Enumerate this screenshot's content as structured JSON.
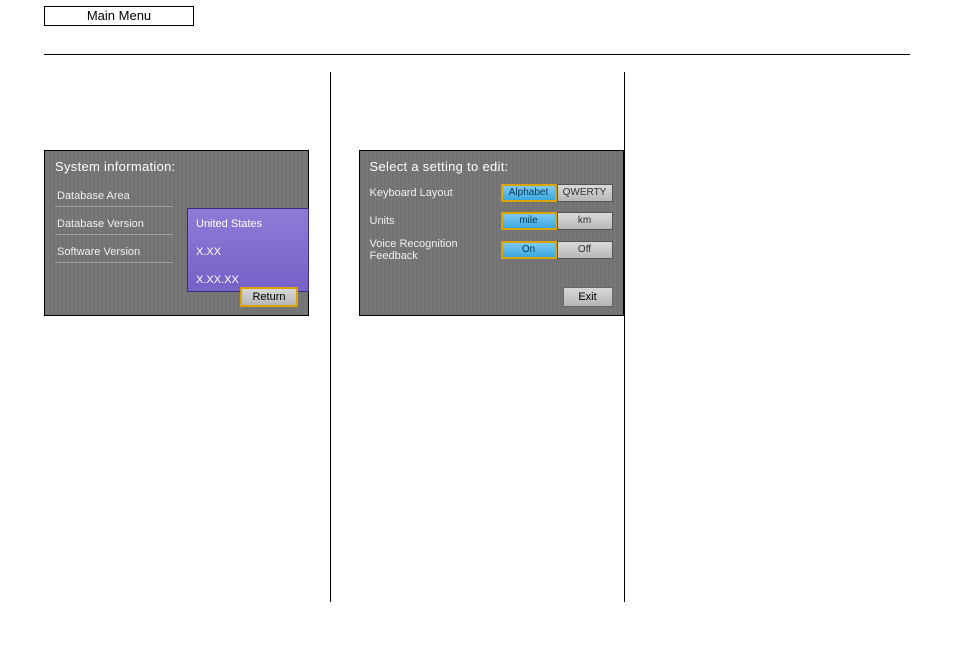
{
  "header": {
    "main_menu": "Main Menu"
  },
  "system_info": {
    "title": "System information:",
    "rows": [
      {
        "label": "Database Area",
        "value": "United States"
      },
      {
        "label": "Database Version",
        "value": "X.XX"
      },
      {
        "label": "Software Version",
        "value": "X.XX.XX"
      }
    ],
    "return_label": "Return"
  },
  "settings": {
    "title": "Select a setting to edit:",
    "rows": [
      {
        "label": "Keyboard Layout",
        "options": [
          "Alphabet",
          "QWERTY"
        ],
        "active": 0
      },
      {
        "label": "Units",
        "options": [
          "mile",
          "km"
        ],
        "active": 0
      },
      {
        "label": "Voice Recognition Feedback",
        "options": [
          "On",
          "Off"
        ],
        "active": 0
      }
    ],
    "exit_label": "Exit"
  }
}
